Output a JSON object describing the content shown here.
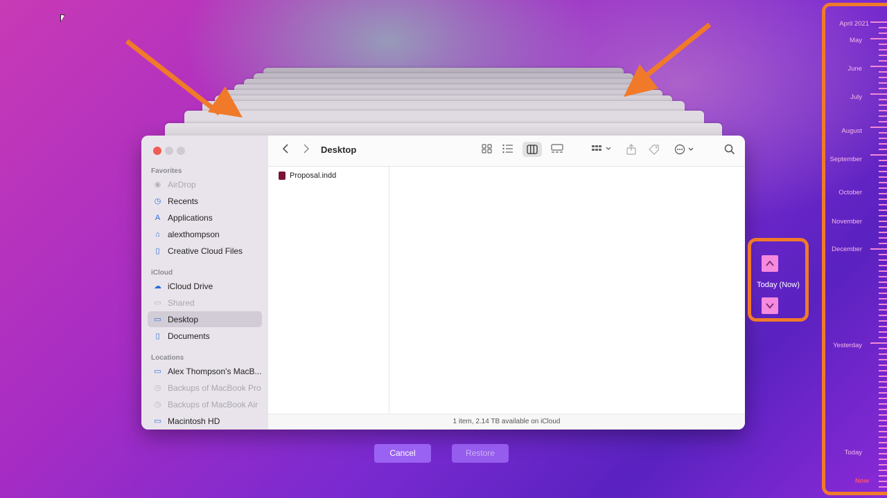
{
  "window": {
    "title": "Desktop",
    "sidebar": {
      "sections": [
        {
          "title": "Favorites",
          "items": [
            {
              "label": "AirDrop",
              "icon": "airdrop-icon",
              "dim": true
            },
            {
              "label": "Recents",
              "icon": "clock-icon"
            },
            {
              "label": "Applications",
              "icon": "applications-icon"
            },
            {
              "label": "alexthompson",
              "icon": "home-icon"
            },
            {
              "label": "Creative Cloud Files",
              "icon": "document-icon"
            }
          ]
        },
        {
          "title": "iCloud",
          "items": [
            {
              "label": "iCloud Drive",
              "icon": "cloud-icon"
            },
            {
              "label": "Shared",
              "icon": "shared-folder-icon",
              "dim": true
            },
            {
              "label": "Desktop",
              "icon": "desktop-icon",
              "selected": true
            },
            {
              "label": "Documents",
              "icon": "document-icon"
            }
          ]
        },
        {
          "title": "Locations",
          "items": [
            {
              "label": "Alex Thompson's MacB...",
              "icon": "laptop-icon"
            },
            {
              "label": "Backups of MacBook Pro",
              "icon": "time-machine-icon",
              "dim": true
            },
            {
              "label": "Backups of MacBook Air",
              "icon": "time-machine-icon",
              "dim": true
            },
            {
              "label": "Macintosh HD",
              "icon": "drive-icon"
            }
          ]
        }
      ]
    },
    "files": [
      {
        "name": "Proposal.indd",
        "icon": "indesign-file-icon"
      }
    ],
    "status": "1 item, 2.14 TB available on iCloud"
  },
  "buttons": {
    "cancel": "Cancel",
    "restore": "Restore"
  },
  "navigator": {
    "label": "Today (Now)"
  },
  "timeline": {
    "labels": [
      "April 2021",
      "May",
      "June",
      "July",
      "August",
      "September",
      "October",
      "November",
      "December",
      "Yesterday",
      "Today",
      "Now"
    ]
  },
  "colors": {
    "accent": "#f07a2a",
    "button": "#9a62f2",
    "timeline": "#f48ad6",
    "now": "#ff4f6e"
  }
}
